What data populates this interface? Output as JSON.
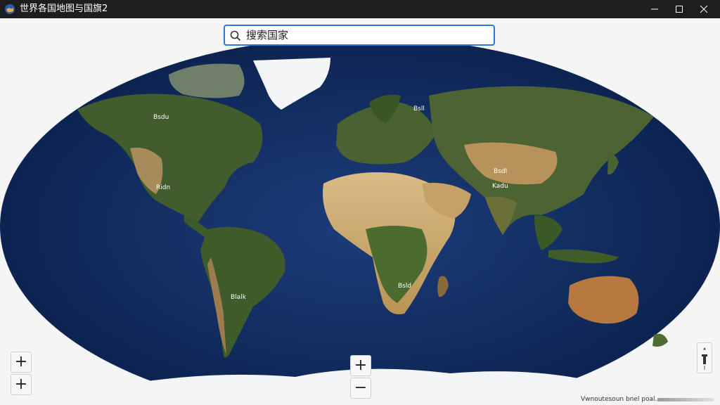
{
  "window": {
    "title": "世界各国地图与国旗2"
  },
  "search": {
    "placeholder": "搜索国家"
  },
  "controls": {
    "zoom_in_left_1": "+",
    "zoom_in_left_2": "+",
    "zoom_in_center": "+",
    "zoom_out_center": "−"
  },
  "attribution": {
    "text": "Vwnoutesoun bnel poal."
  },
  "colors": {
    "ocean": "#0f2a5c",
    "land_green": "#3f5a2a",
    "land_desert": "#c9a56b",
    "ice": "#f4f6f8",
    "accent": "#2d7ad6"
  },
  "icons": {
    "app": "globe-icon",
    "search": "search-icon",
    "compass": "compass-icon"
  }
}
